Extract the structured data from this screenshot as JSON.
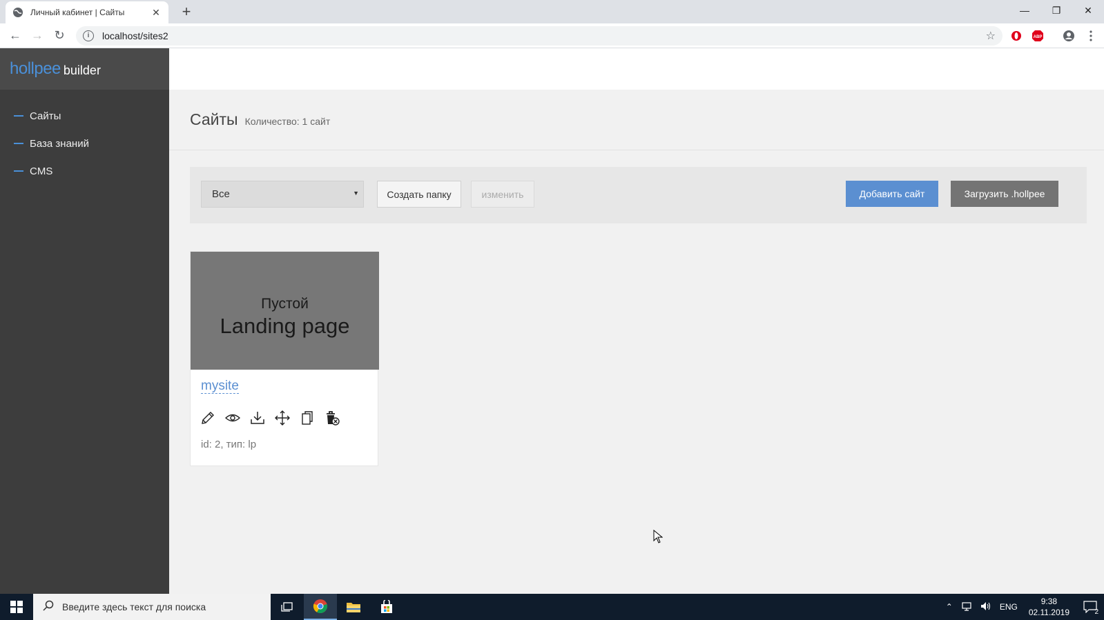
{
  "browser": {
    "tab_title": "Личный кабинет | Сайты",
    "url": "localhost/sites2",
    "new_tab_label": "+",
    "tab_close_label": "✕"
  },
  "sidebar": {
    "logo_main": "hollpee",
    "logo_sub": "builder",
    "items": [
      {
        "label": "Сайты"
      },
      {
        "label": "База знаний"
      },
      {
        "label": "CMS"
      }
    ]
  },
  "page": {
    "title": "Сайты",
    "count": "Количество: 1 сайт"
  },
  "toolbar": {
    "filter_value": "Все",
    "create_folder_label": "Создать папку",
    "edit_label": "изменить",
    "add_site_label": "Добавить сайт",
    "upload_label": "Загрузить .hollpee"
  },
  "sites": [
    {
      "thumb_line1": "Пустой",
      "thumb_line2": "Landing page",
      "name": "mysite",
      "meta": "id: 2, тип: lp",
      "actions": [
        "pencil-icon",
        "eye-icon",
        "download-icon",
        "move-icon",
        "copy-icon",
        "delete-icon"
      ]
    }
  ],
  "taskbar": {
    "search_placeholder": "Введите здесь текст для поиска",
    "lang": "ENG",
    "time": "9:38",
    "date": "02.11.2019",
    "notif_count": "2"
  },
  "colors": {
    "accent": "#5b8fd1",
    "sidebar_bg": "#3d3d3d",
    "upload_btn": "#747474"
  }
}
